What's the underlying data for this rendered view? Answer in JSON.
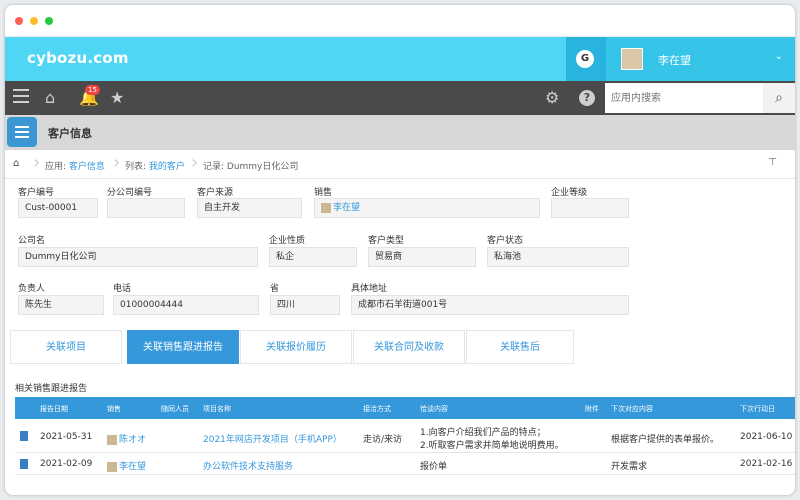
{
  "header": {
    "brand": "cybozu.com",
    "g_label": "G",
    "user_name": "李在望"
  },
  "nav": {
    "notification_count": "15",
    "search_placeholder": "应用内搜索"
  },
  "app": {
    "title": "客户信息"
  },
  "breadcrumb": {
    "app_prefix": "应用: ",
    "app_link": "客户信息",
    "list_prefix": "列表: ",
    "list_link": "我的客户",
    "record": "记录: Dummy日化公司"
  },
  "fields": {
    "customer_id": {
      "label": "客户编号",
      "value": "Cust-00001"
    },
    "branch_id": {
      "label": "分公司编号",
      "value": ""
    },
    "source": {
      "label": "客户来源",
      "value": "自主开发"
    },
    "sales": {
      "label": "销售",
      "value": "李在望"
    },
    "level": {
      "label": "企业等级",
      "value": ""
    },
    "company": {
      "label": "公司名",
      "value": "Dummy日化公司"
    },
    "nature": {
      "label": "企业性质",
      "value": "私企"
    },
    "type": {
      "label": "客户类型",
      "value": "贸易商"
    },
    "status": {
      "label": "客户状态",
      "value": "私海池"
    },
    "contact": {
      "label": "负责人",
      "value": "陈先生"
    },
    "phone": {
      "label": "电话",
      "value": "01000004444"
    },
    "province": {
      "label": "省",
      "value": "四川"
    },
    "address": {
      "label": "具体地址",
      "value": "成都市石羊街道001号"
    }
  },
  "tabs": [
    "关联项目",
    "关联销售跟进报告",
    "关联报价履历",
    "关联合同及收款",
    "关联售后"
  ],
  "section_title": "相关销售跟进报告",
  "table": {
    "headers": [
      "报告日期",
      "销售",
      "随同人员",
      "项目名称",
      "接洽方式",
      "恰谈内容",
      "附件",
      "下次对应内容",
      "下次行动日"
    ],
    "rows": [
      {
        "date": "2021-05-31",
        "sales": "陈オオ",
        "companion": "",
        "project": "2021年网店开发项目（手机APP）",
        "method": "走访/来访",
        "content1": "1.向客户介绍我们产品的特点；",
        "content2": "2.听取客户需求并简单地说明费用。",
        "attachment": "",
        "next_content": "根据客户提供的表单报价。",
        "next_date": "2021-06-10"
      },
      {
        "date": "2021-02-09",
        "sales": "李在望",
        "companion": "",
        "project": "办公软件技术支持服务",
        "method": "",
        "content1": "报价单",
        "content2": "",
        "attachment": "",
        "next_content": "开发需求",
        "next_date": "2021-02-16"
      }
    ]
  }
}
